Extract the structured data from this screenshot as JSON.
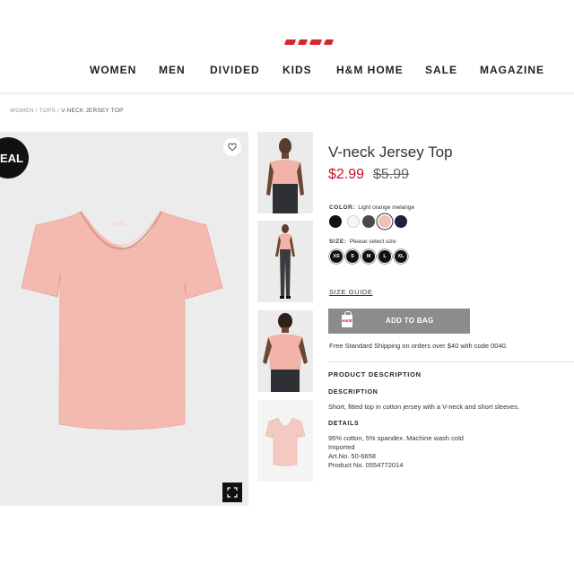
{
  "brand": {
    "logo_text": "H&M"
  },
  "nav": {
    "items": [
      {
        "label": "WOMEN"
      },
      {
        "label": "MEN"
      },
      {
        "label": "DIVIDED"
      },
      {
        "label": "KIDS"
      },
      {
        "label": "H&M HOME"
      },
      {
        "label": "SALE"
      },
      {
        "label": "MAGAZINE"
      }
    ]
  },
  "breadcrumb": {
    "items": [
      "WOMEN",
      "TOPS",
      "V-NECK JERSEY TOP"
    ],
    "separator": "/"
  },
  "gallery": {
    "deal_badge": "DEAL",
    "favorite_icon": "heart-icon",
    "expand_icon": "expand-icon",
    "main_image": "pink-v-neck-t-shirt",
    "thumbnails": [
      "model-front-view",
      "model-full-body",
      "model-back-view",
      "product-flat-view"
    ]
  },
  "product": {
    "title": "V-neck Jersey Top",
    "price_current": "$2.99",
    "price_original": "$5.99",
    "price_color": "#c8102e",
    "color": {
      "label": "COLOR:",
      "selected_name": "Light orange melange",
      "swatches": [
        {
          "name": "black",
          "hex": "#111111",
          "selected": false
        },
        {
          "name": "white",
          "hex": "#f7f7f7",
          "selected": false
        },
        {
          "name": "dark gray",
          "hex": "#4a4a4a",
          "selected": false
        },
        {
          "name": "light orange melange",
          "hex": "#f1c1b8",
          "selected": true
        },
        {
          "name": "navy",
          "hex": "#1b2140",
          "selected": false
        }
      ]
    },
    "size": {
      "label": "SIZE:",
      "prompt": "Please select size",
      "options": [
        "XS",
        "S",
        "M",
        "L",
        "XL"
      ]
    },
    "size_guide": "SIZE GUIDE",
    "add_to_bag": "ADD TO BAG",
    "bag_icon_text": "H&M",
    "shipping_note": "Free Standard Shipping on orders over $40 with code 0040."
  },
  "description": {
    "heading": "PRODUCT DESCRIPTION",
    "description_label": "DESCRIPTION",
    "description_text": "Short, fitted top in cotton jersey with a V-neck and short sleeves.",
    "details_label": "DETAILS",
    "details_lines": [
      "95% cotton, 5% spandex. Machine wash cold",
      "Imported",
      "Art.No. 50-6658",
      "Product No. 0554772014"
    ]
  }
}
